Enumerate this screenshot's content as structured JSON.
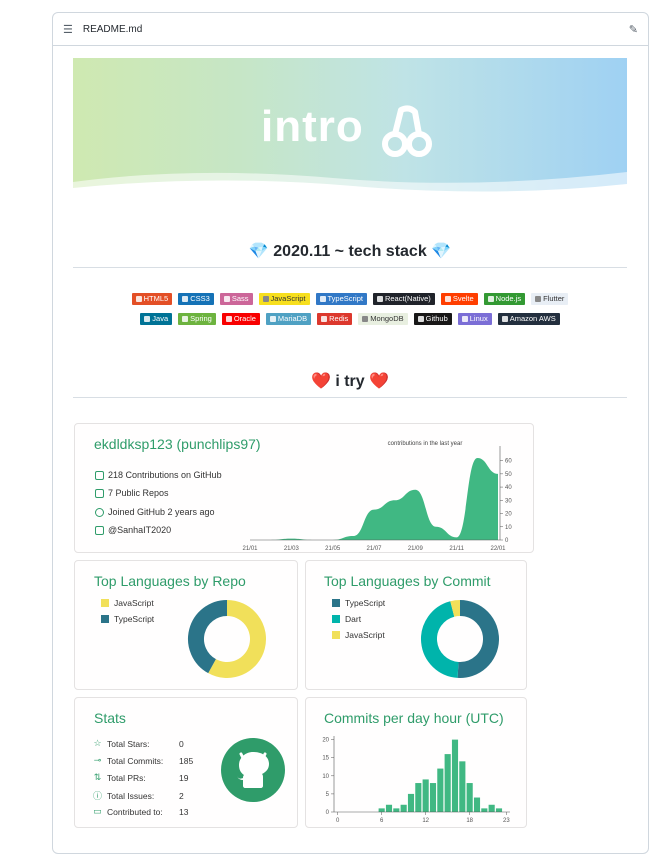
{
  "readme": {
    "filename": "README.md"
  },
  "banner": {
    "title": "intro"
  },
  "tech_stack": {
    "title": "2020.11 ~ tech stack",
    "badges_row1": [
      {
        "label": "HTML5",
        "color": "#e34f26"
      },
      {
        "label": "CSS3",
        "color": "#1572b6"
      },
      {
        "label": "Sass",
        "color": "#cc6699"
      },
      {
        "label": "JavaScript",
        "color": "#f7df1e",
        "text": "#333333"
      },
      {
        "label": "TypeScript",
        "color": "#3178c6"
      },
      {
        "label": "React(Native)",
        "color": "#20232a"
      },
      {
        "label": "Svelte",
        "color": "#ff3e00"
      },
      {
        "label": "Node.js",
        "color": "#339933"
      },
      {
        "label": "Flutter",
        "color": "#e8eef5",
        "text": "#333333"
      }
    ],
    "badges_row2": [
      {
        "label": "Java",
        "color": "#007396"
      },
      {
        "label": "Spring",
        "color": "#6db33f"
      },
      {
        "label": "Oracle",
        "color": "#f80000"
      },
      {
        "label": "MariaDB",
        "color": "#4fa1c3"
      },
      {
        "label": "Redis",
        "color": "#dc382d"
      },
      {
        "label": "MongoDB",
        "color": "#e8efe0",
        "text": "#333333"
      },
      {
        "label": "Github",
        "color": "#181717"
      },
      {
        "label": "Linux",
        "color": "#7b6ed6"
      },
      {
        "label": "Amazon AWS",
        "color": "#232f3e"
      }
    ]
  },
  "i_try": {
    "title": "i try"
  },
  "profile": {
    "name": "ekdldksp123 (punchlips97)",
    "rows": [
      "218 Contributions on GitHub",
      "7 Public Repos",
      "Joined GitHub 2 years ago",
      "@SanhaIT2020"
    ],
    "graph_title": "contributions in the last year",
    "x_labels": [
      "21/01",
      "21/03",
      "21/05",
      "21/07",
      "21/09",
      "21/11",
      "22/01"
    ],
    "y_labels": [
      "0",
      "10",
      "20",
      "30",
      "40",
      "50",
      "60"
    ]
  },
  "chart_data": [
    {
      "type": "area",
      "title": "contributions in the last year",
      "x": [
        "21/01",
        "21/02",
        "21/03",
        "21/04",
        "21/05",
        "21/06",
        "21/07",
        "21/08",
        "21/09",
        "21/10",
        "21/11",
        "21/12",
        "22/01"
      ],
      "values": [
        0,
        0,
        1,
        0,
        0,
        3,
        23,
        30,
        38,
        10,
        2,
        62,
        50
      ],
      "ylim": [
        0,
        65
      ]
    },
    {
      "type": "pie",
      "title": "Top Languages by Repo",
      "categories": [
        "JavaScript",
        "TypeScript"
      ],
      "values": [
        58,
        42
      ],
      "colors": [
        "#f1e05a",
        "#2b7489"
      ]
    },
    {
      "type": "pie",
      "title": "Top Languages by Commit",
      "categories": [
        "TypeScript",
        "Dart",
        "JavaScript"
      ],
      "values": [
        51,
        45,
        4
      ],
      "colors": [
        "#2b7489",
        "#00b4ab",
        "#f1e05a"
      ]
    },
    {
      "type": "bar",
      "title": "Commits per day hour (UTC)",
      "categories": [
        "0",
        "1",
        "2",
        "3",
        "4",
        "5",
        "6",
        "7",
        "8",
        "9",
        "10",
        "11",
        "12",
        "13",
        "14",
        "15",
        "16",
        "17",
        "18",
        "19",
        "20",
        "21",
        "22",
        "23"
      ],
      "values": [
        0,
        0,
        0,
        0,
        0,
        0,
        1,
        2,
        1,
        2,
        5,
        8,
        9,
        8,
        12,
        16,
        20,
        14,
        8,
        4,
        1,
        2,
        1,
        0
      ],
      "x_ticks": [
        "0",
        "6",
        "12",
        "18",
        "23"
      ],
      "y_ticks": [
        "0",
        "5",
        "10",
        "15",
        "20"
      ],
      "ylim": [
        0,
        21
      ]
    }
  ],
  "lang_repo": {
    "title": "Top Languages by Repo",
    "legend": [
      "JavaScript",
      "TypeScript"
    ]
  },
  "lang_commit": {
    "title": "Top Languages by Commit",
    "legend": [
      "TypeScript",
      "Dart",
      "JavaScript"
    ]
  },
  "stats": {
    "title": "Stats",
    "rows": [
      {
        "label": "Total Stars:",
        "value": "0"
      },
      {
        "label": "Total Commits:",
        "value": "185"
      },
      {
        "label": "Total PRs:",
        "value": "19"
      },
      {
        "label": "Total Issues:",
        "value": "2"
      },
      {
        "label": "Contributed to:",
        "value": "13"
      }
    ]
  },
  "commits_hour": {
    "title": "Commits per day hour (UTC)"
  },
  "colors": {
    "accent": "#2f9c6a",
    "area": "#40b883",
    "border": "#d0d7de"
  }
}
